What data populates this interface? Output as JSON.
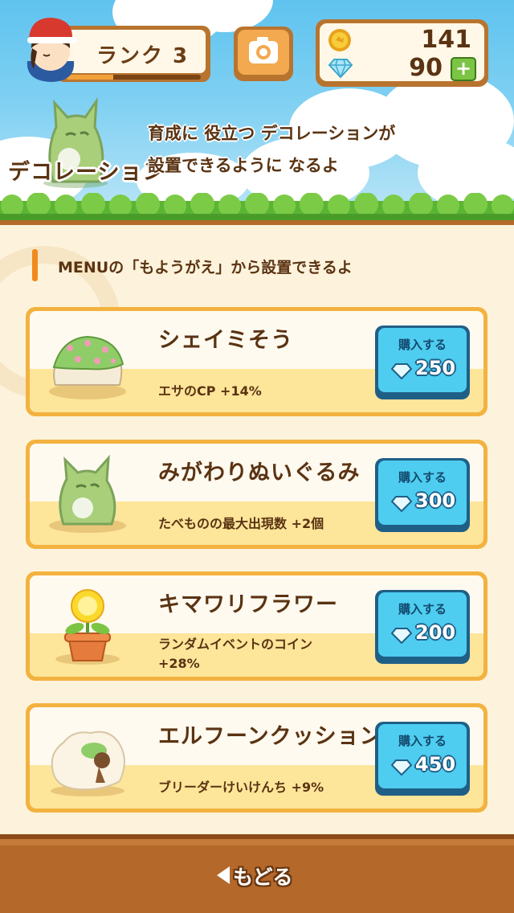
{
  "header": {
    "rank_label": "ランク 3",
    "rank_progress": 0.35,
    "coins": "141",
    "gems": "90",
    "plus_label": "+"
  },
  "deco": {
    "title": "デコレーション",
    "desc_line1": "育成に 役立つ デコレーションが",
    "desc_line2": "設置できるように なるよ"
  },
  "notice": "MENUの「もようがえ」から設置できるよ",
  "buy_label": "購入する",
  "items": [
    {
      "name": "シェイミそう",
      "effect": "エサのCP +14%",
      "effect2": "",
      "price": "250"
    },
    {
      "name": "みがわりぬいぐるみ",
      "effect": "たべものの最大出現数 +2個",
      "effect2": "",
      "price": "300"
    },
    {
      "name": "キマワリフラワー",
      "effect": "ランダムイベントのコイン",
      "effect2": "+28%",
      "price": "200"
    },
    {
      "name": "エルフーンクッション",
      "effect": "ブリーダーけいけんち +9%",
      "effect2": "",
      "price": "450"
    }
  ],
  "footer": {
    "back_label": "もどる"
  },
  "colors": {
    "accent": "#f08a1e",
    "frame": "#b8742f",
    "button": "#4ecdf0",
    "card_border": "#f3b23f"
  }
}
